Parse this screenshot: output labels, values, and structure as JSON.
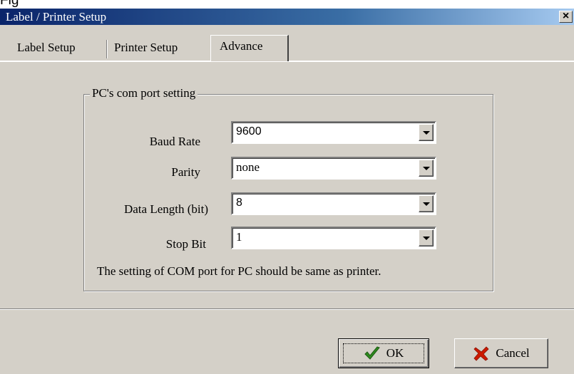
{
  "dialog": {
    "title": "Label / Printer Setup",
    "close_label": "×",
    "top_clip_text": "Fig"
  },
  "tabs": [
    {
      "label": "Label Setup",
      "active": false
    },
    {
      "label": "Printer Setup",
      "active": false
    },
    {
      "label": "Advance",
      "active": true
    }
  ],
  "group": {
    "title": "PC's com port setting",
    "fields": [
      {
        "label": "Baud Rate",
        "value": "9600"
      },
      {
        "label": "Parity",
        "value": "none"
      },
      {
        "label": "Data Length (bit)",
        "value": "8"
      },
      {
        "label": "Stop Bit",
        "value": "1"
      }
    ],
    "note": "The setting of COM port for PC should be same as printer."
  },
  "buttons": {
    "ok": "OK",
    "cancel": "Cancel"
  },
  "icons": {
    "ok": "checkmark-icon",
    "cancel": "x-icon",
    "dropdown": "chevron-down-icon"
  },
  "colors": {
    "title_start": "#0a246a",
    "title_end": "#a6caf0",
    "face": "#d4d0c8",
    "check_green": "#2e8b1f",
    "cancel_red": "#cc1a00"
  }
}
